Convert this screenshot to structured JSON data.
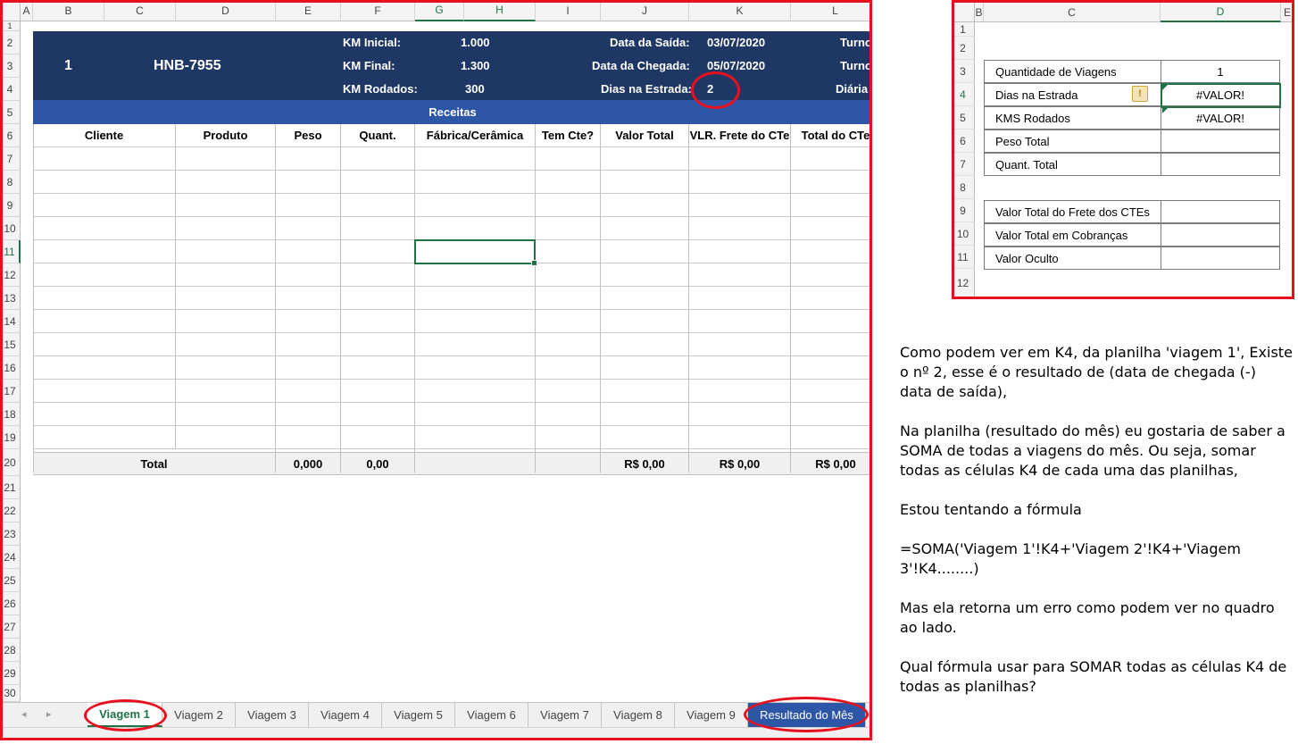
{
  "main_sheet": {
    "columns": [
      "A",
      "B",
      "C",
      "D",
      "E",
      "F",
      "G",
      "H",
      "I",
      "J",
      "K",
      "L"
    ],
    "rows": [
      "1",
      "2",
      "3",
      "4",
      "5",
      "6",
      "7",
      "8",
      "9",
      "10",
      "11",
      "12",
      "13",
      "14",
      "15",
      "16",
      "17",
      "18",
      "19",
      "20",
      "21",
      "22",
      "23",
      "24",
      "25",
      "26",
      "27",
      "28",
      "29",
      "30"
    ],
    "header_block": {
      "trip_number": "1",
      "plate": "HNB-7955",
      "km_inicial_label": "KM Inicial:",
      "km_inicial_value": "1.000",
      "km_final_label": "KM Final:",
      "km_final_value": "1.300",
      "km_rodados_label": "KM Rodados:",
      "km_rodados_value": "300",
      "data_saida_label": "Data da Saída:",
      "data_saida_value": "03/07/2020",
      "data_chegada_label": "Data da Chegada:",
      "data_chegada_value": "05/07/2020",
      "dias_estrada_label": "Dias na Estrada:",
      "dias_estrada_value": "2",
      "turno_1": "Turno",
      "turno_2": "Turno",
      "diaria": "Diária"
    },
    "section_title": "Receitas",
    "table_headers": [
      "Cliente",
      "Produto",
      "Peso",
      "Quant.",
      "Fábrica/Cerâmica",
      "Tem Cte?",
      "Valor Total",
      "VLR. Frete do CTe",
      "Total do CTe"
    ],
    "totals": {
      "label": "Total",
      "peso": "0,000",
      "quant": "0,00",
      "valor_total": "R$ 0,00",
      "vlr_frete": "R$ 0,00",
      "total_cte": "R$ 0,00"
    },
    "tabs": [
      "Viagem 1",
      "Viagem 2",
      "Viagem 3",
      "Viagem 4",
      "Viagem 5",
      "Viagem 6",
      "Viagem 7",
      "Viagem 8",
      "Viagem 9",
      "Resultado do Mês"
    ],
    "active_tab": "Viagem 1",
    "nav_prev": "◂",
    "nav_next": "▸"
  },
  "mini_sheet": {
    "columns": [
      "B",
      "C",
      "D",
      "E"
    ],
    "rows": [
      "1",
      "2",
      "3",
      "4",
      "5",
      "6",
      "7",
      "8",
      "9",
      "10",
      "11",
      "12"
    ],
    "items": [
      {
        "label": "Quantidade de Viagens",
        "value": "1"
      },
      {
        "label": "Dias na Estrada",
        "value": "#VALOR!"
      },
      {
        "label": "KMS Rodados",
        "value": "#VALOR!"
      },
      {
        "label": "Peso Total",
        "value": ""
      },
      {
        "label": "Quant. Total",
        "value": ""
      },
      {
        "label": "Valor Total do Frete dos CTEs",
        "value": ""
      },
      {
        "label": "Valor Total em Cobranças",
        "value": ""
      },
      {
        "label": "Valor Oculto",
        "value": ""
      }
    ],
    "warning_glyph": "!"
  },
  "explanation": {
    "p1": "Como podem ver em K4, da planilha 'viagem 1', Existe o nº 2, esse é o resultado de (data de chegada (-) data de saída),",
    "p2": "Na planilha (resultado do mês) eu gostaria de saber a SOMA de todas a viagens do mês. Ou seja, somar todas as células K4 de cada uma das planilhas,",
    "p3": "Estou tentando a fórmula",
    "p4": "=SOMA('Viagem 1'!K4+'Viagem 2'!K4+'Viagem 3'!K4........)",
    "p5": "Mas ela retorna um erro como podem ver no quadro ao lado.",
    "p6": "Qual fórmula usar para SOMAR todas as células K4 de todas as planilhas?"
  },
  "colors": {
    "navy_header": "#1f3764",
    "receitas_band": "#2e56a6",
    "excel_green": "#217346",
    "annotation_red": "#e8101e"
  }
}
